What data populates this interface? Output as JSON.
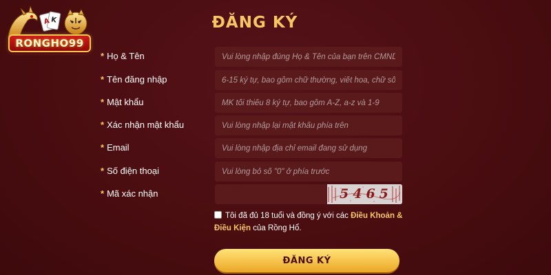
{
  "brand": {
    "logo_text": "RONGHO99"
  },
  "form": {
    "title": "ĐĂNG KÝ",
    "required_marker": "*",
    "fields": [
      {
        "label": "Họ & Tên",
        "placeholder": "Vui lòng nhập đúng Họ & Tên của bạn trên CMND",
        "value": ""
      },
      {
        "label": "Tên đăng nhập",
        "placeholder": "6-15 ký tự, bao gồm chữ thường, viết hoa, chữ số",
        "value": ""
      },
      {
        "label": "Mật khẩu",
        "placeholder": "MK tối thiểu 8 ký tự, bao gồm A-Z, a-z và 1-9",
        "value": ""
      },
      {
        "label": "Xác nhận mật khẩu",
        "placeholder": "Vui lòng nhập lại mật khẩu phía trên",
        "value": ""
      },
      {
        "label": "Email",
        "placeholder": "Vui lòng nhập địa chỉ email đang sử dụng",
        "value": ""
      },
      {
        "label": "Số điện thoại",
        "placeholder": "Vui lòng bỏ số \"0\" ở phía trước",
        "value": ""
      }
    ],
    "captcha": {
      "label": "Mã xác nhận",
      "value": "",
      "code": "5465"
    },
    "terms": {
      "checked": false,
      "text_before": "Tôi đã đủ 18 tuổi và đồng ý với các ",
      "link_text": "Điều Khoản & Điều Kiện",
      "text_after": " của Rồng Hổ."
    },
    "submit_label": "ĐĂNG KÝ"
  },
  "colors": {
    "background": "#4a0d0f",
    "accent_gold": "#f6c564",
    "field_bg": "#5a1a1c"
  }
}
